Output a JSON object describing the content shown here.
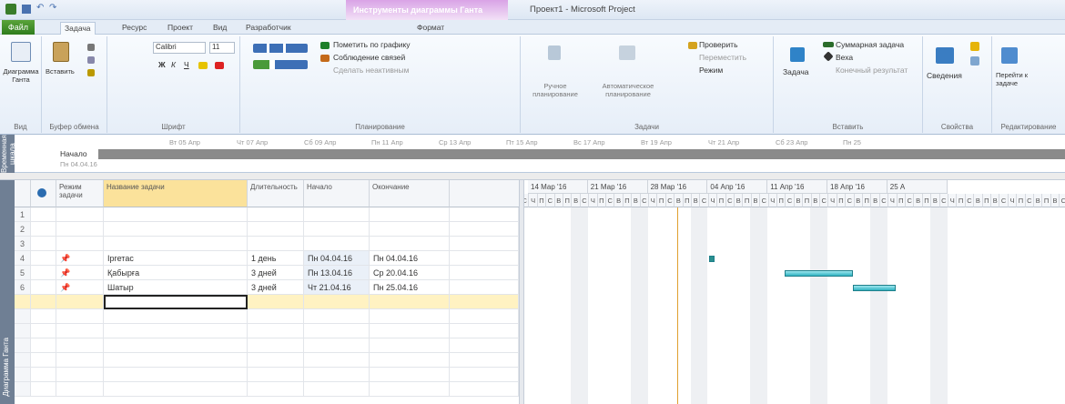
{
  "window": {
    "title": "Проект1 - Microsoft Project",
    "context_group": "Инструменты диаграммы Ганта"
  },
  "tabs": [
    {
      "label": "Задача"
    },
    {
      "label": "Ресурс"
    },
    {
      "label": "Проект"
    },
    {
      "label": "Вид"
    },
    {
      "label": "Разработчик"
    },
    {
      "label": "Формат"
    }
  ],
  "file_tab": "Файл",
  "ribbon": {
    "view": {
      "label": "Диаграмма Ганта",
      "group": "Вид"
    },
    "clipboard": {
      "paste": "Вставить",
      "group": "Буфер обмена"
    },
    "font": {
      "name": "Calibri",
      "size": "11",
      "bold": "Ж",
      "italic": "К",
      "underline": "Ч",
      "group": "Шрифт"
    },
    "schedule": {
      "mark": "Пометить по графику",
      "respect": "Соблюдение связей",
      "inactivate": "Сделать неактивным",
      "group": "Планирование"
    },
    "tasks": {
      "manual": "Ручное планирование",
      "auto": "Автоматическое планирование",
      "inspect": "Проверить",
      "move": "Переместить",
      "mode": "Режим",
      "group": "Задачи"
    },
    "insert": {
      "task": "Задача",
      "summary": "Суммарная задача",
      "milestone": "Веха",
      "deliverable": "Конечный результат",
      "group": "Вставить"
    },
    "properties": {
      "info": "Сведения",
      "group": "Свойства"
    },
    "editing": {
      "scroll": "Перейти к задаче",
      "group": "Редактирование"
    }
  },
  "timeline": {
    "side": "Временная шкала",
    "start_label": "Начало",
    "start_date": "Пн 04.04.16",
    "dates": [
      "Вт 05 Апр",
      "Чт 07 Апр",
      "Сб 09 Апр",
      "Пн 11 Апр",
      "Ср 13 Апр",
      "Пт 15 Апр",
      "Вс 17 Апр",
      "Вт 19 Апр",
      "Чт 21 Апр",
      "Сб 23 Апр",
      "Пн 25"
    ]
  },
  "side_view": "Диаграмма Ганта",
  "grid": {
    "headers": {
      "mode": "Режим задачи",
      "name": "Название задачи",
      "duration": "Длительность",
      "start": "Начало",
      "finish": "Окончание"
    },
    "rows": [
      {
        "id": "1",
        "name": "",
        "duration": "",
        "start": "",
        "finish": "",
        "pinned": false
      },
      {
        "id": "2",
        "name": "",
        "duration": "",
        "start": "",
        "finish": "",
        "pinned": false
      },
      {
        "id": "3",
        "name": "",
        "duration": "",
        "start": "",
        "finish": "",
        "pinned": false
      },
      {
        "id": "4",
        "name": "Іргетас",
        "duration": "1 день",
        "start": "Пн 04.04.16",
        "finish": "Пн 04.04.16",
        "pinned": true
      },
      {
        "id": "5",
        "name": "Қабырға",
        "duration": "3 дней",
        "start": "Пн 13.04.16",
        "finish": "Ср 20.04.16",
        "pinned": true
      },
      {
        "id": "6",
        "name": "Шатыр",
        "duration": "3 дней",
        "start": "Чт 21.04.16",
        "finish": "Пн 25.04.16",
        "pinned": true
      }
    ]
  },
  "gantt": {
    "weeks": [
      "14 Мар '16",
      "21 Мар '16",
      "28 Мар '16",
      "04 Апр '16",
      "11 Апр '16",
      "18 Апр '16",
      "25 А"
    ],
    "day_letters": [
      "С",
      "Ч",
      "П",
      "С",
      "В",
      "П",
      "В"
    ]
  },
  "colors": {
    "bar": "#2fb3c2",
    "context": "#d9a3e6",
    "file": "#3f8f2a"
  }
}
